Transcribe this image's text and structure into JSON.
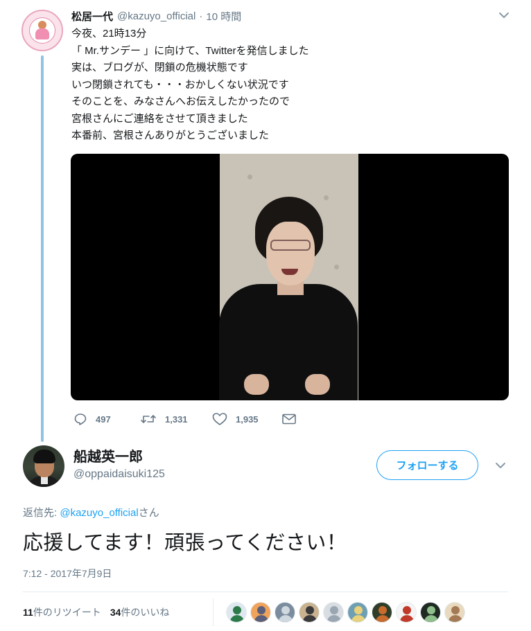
{
  "parent_tweet": {
    "name": "松居一代",
    "handle": "@kazuyo_official",
    "separator": "·",
    "time": "10 時間",
    "lines": [
      "今夜、21時13分",
      "「 Mr.サンデー 」に向けて、Twitterを発信しました",
      "実は、ブログが、閉鎖の危機状態です",
      "いつ閉鎖されても・・・おかしくない状況です",
      "そのことを、みなさんへお伝えしたかったので",
      "宮根さんにご連絡をさせて頂きました",
      "本番前、宮根さんありがとうございました"
    ],
    "actions": {
      "reply_count": "497",
      "retweet_count": "1,331",
      "like_count": "1,935"
    }
  },
  "main_tweet": {
    "name": "船越英一郎",
    "handle": "@oppaidaisuki125",
    "follow_label": "フォローする",
    "reply_prefix": "返信先: ",
    "reply_mention": "@kazuyo_official",
    "reply_suffix": "さん",
    "text": "応援してます！頑張ってください！",
    "timestamp": "7:12 - 2017年7月9日",
    "retweet_count": "11",
    "retweet_label": "件のリツイート",
    "like_count": "34",
    "like_label": "件のいいね"
  },
  "colors": {
    "accent": "#1da1f2",
    "thread_line": "#90c4e3",
    "secondary_text": "#657786",
    "primary_text": "#14171a"
  },
  "icons": [
    "reply-icon",
    "retweet-icon",
    "heart-icon",
    "envelope-icon",
    "chevron-down-icon"
  ],
  "liker_avatars": [
    {
      "bg": "#dfe8ef",
      "fg": "#2c7a4a"
    },
    {
      "bg": "#f0a35a",
      "fg": "#5b5f7a"
    },
    {
      "bg": "#7a8c9e",
      "fg": "#cfd8de"
    },
    {
      "bg": "#c9b28f",
      "fg": "#3a3a3a"
    },
    {
      "bg": "#d8dde2",
      "fg": "#9aa6b1"
    },
    {
      "bg": "#6f9fb2",
      "fg": "#e9d27b"
    },
    {
      "bg": "#2f3d2a",
      "fg": "#c96b2c"
    },
    {
      "bg": "#f4f4f4",
      "fg": "#c0392b"
    },
    {
      "bg": "#1e2a22",
      "fg": "#8fbf8a"
    },
    {
      "bg": "#e8d9bf",
      "fg": "#a37a55"
    }
  ]
}
